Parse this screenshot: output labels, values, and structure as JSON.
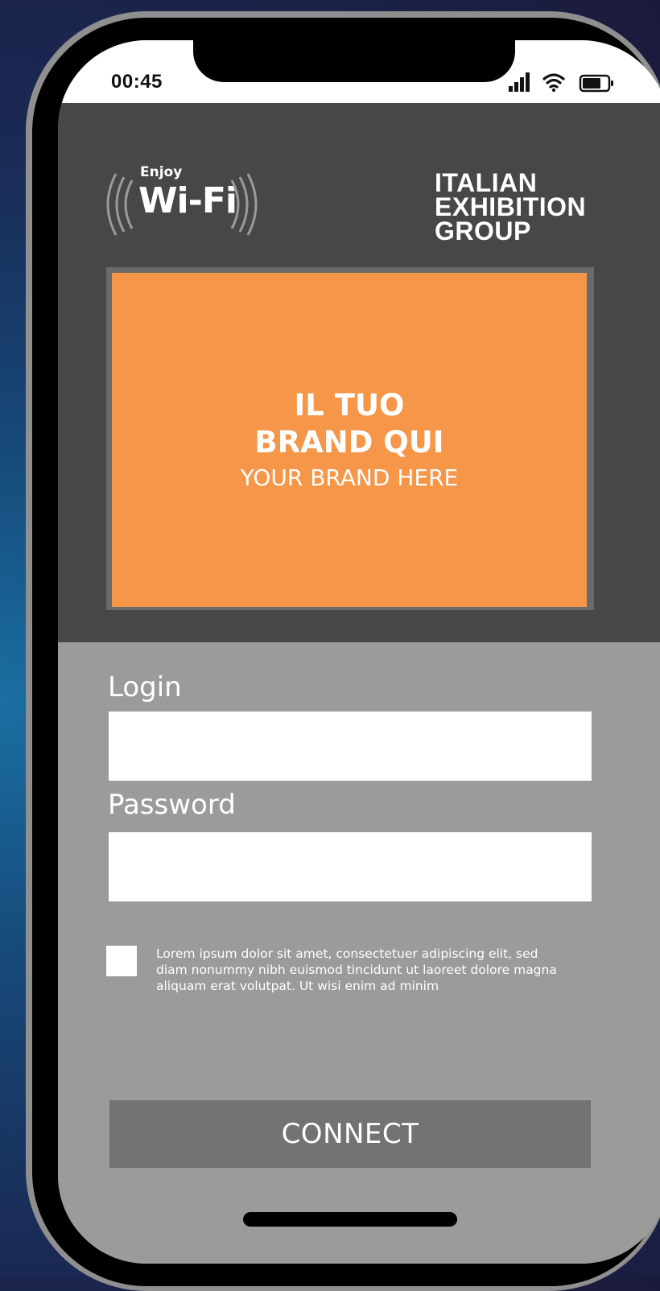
{
  "status_bar": {
    "time": "00:45",
    "icons": [
      "cellular-signal-icon",
      "wifi-icon",
      "battery-icon"
    ]
  },
  "header": {
    "wifi_logo": {
      "small_text": "Enjoy",
      "main_text": "Wi-Fi"
    },
    "company_logo": {
      "line1": "ITALIAN",
      "line2": "EXHIBITION",
      "line3": "GROUP"
    },
    "brand_placeholder": {
      "title": "IL TUO\nBRAND QUI",
      "subtitle": "YOUR BRAND HERE"
    }
  },
  "form": {
    "login_label": "Login",
    "login_value": "",
    "password_label": "Password",
    "password_value": "",
    "consent_checked": false,
    "consent_text": "Lorem ipsum dolor sit amet, consectetuer adipiscing elit, sed diam nonummy nibh euismod tincidunt ut laoreet dolore magna aliquam erat volutpat. Ut wisi enim ad minim",
    "connect_label": "CONNECT"
  },
  "colors": {
    "background_blue": "#1a6fa3",
    "background_dark": "#1b1a3a",
    "header_dark_gray": "#474747",
    "brand_orange": "#f59649",
    "form_gray": "#9b9b9b",
    "button_gray": "#737373",
    "phone_frame_gray": "#8f8f8f"
  }
}
